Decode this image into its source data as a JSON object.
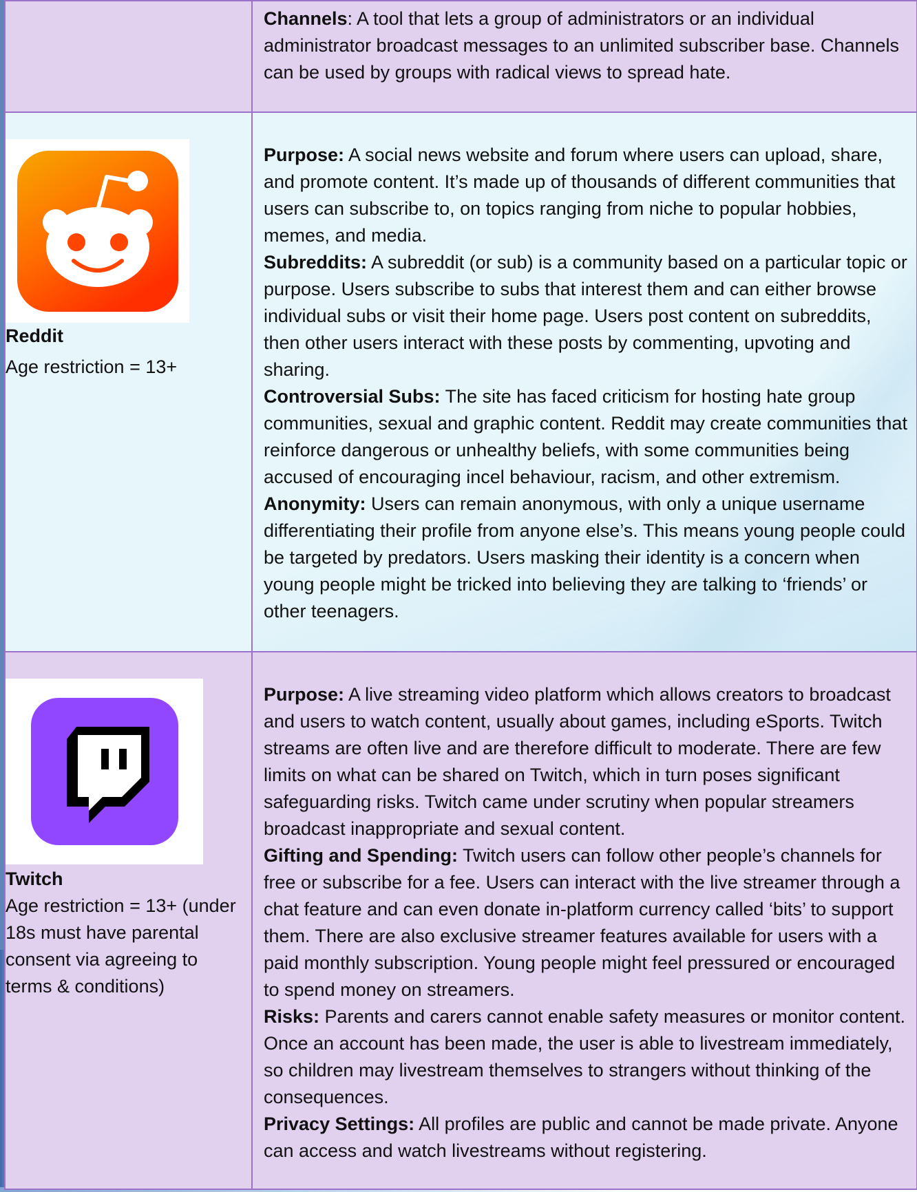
{
  "rows": {
    "channels": {
      "label": "Channels",
      "text": ": A tool that lets a group of administrators or an individual administrator broadcast messages to an unlimited subscriber base. Channels can be used by groups with radical views to spread hate."
    },
    "reddit": {
      "name": "Reddit",
      "age": "Age restriction = 13+",
      "logo_icon": "reddit-alien-icon",
      "colors": {
        "logo_top": "#f7a600",
        "logo_bottom": "#ff3a00"
      },
      "sections": [
        {
          "label": "Purpose:",
          "text": " A social news website and forum where users can upload, share, and promote content. It’s made up of thousands of different communities that users can subscribe to, on topics ranging from niche to popular hobbies, memes, and media."
        },
        {
          "label": "Subreddits:",
          "text": " A subreddit (or sub) is a community based on a particular topic or purpose. Users subscribe to subs that interest them and can either browse individual subs or visit their home page. Users post content on subreddits, then other users interact with these posts by commenting, upvoting and sharing."
        },
        {
          "label": "Controversial Subs:",
          "text": " The site has faced criticism for hosting hate group communities, sexual and graphic content. Reddit may create communities that reinforce dangerous or unhealthy beliefs, with some communities being accused of encouraging incel behaviour, racism, and other extremism."
        },
        {
          "label": "Anonymity:",
          "text": " Users can remain anonymous, with only a unique username differentiating their profile from anyone else’s. This means young people could be targeted by predators. Users masking their identity is a concern when young people might be tricked into believing they are talking to ‘friends’ or other teenagers."
        }
      ]
    },
    "twitch": {
      "name": "Twitch",
      "age": "Age restriction = 13+ (under 18s must have parental consent via agreeing to terms & conditions)",
      "logo_icon": "twitch-glitch-icon",
      "colors": {
        "logo_bg": "#9146ff"
      },
      "sections": [
        {
          "label": "Purpose:",
          "text": " A live streaming video platform which allows creators to broadcast and users to watch content, usually about games, including eSports. Twitch streams are often live and are therefore difficult to moderate. There are few limits on what can be shared on Twitch, which in turn poses significant safeguarding risks. Twitch came under scrutiny when popular streamers broadcast inappropriate and sexual content."
        },
        {
          "label": "Gifting and Spending:",
          "text": " Twitch users can follow other people’s channels for free or subscribe for a fee. Users can interact with the live streamer through a chat feature and can even donate in-platform currency called ‘bits’ to support them. There are also exclusive streamer features available for users with a paid monthly subscription. Young people might feel pressured or encouraged to spend money on streamers."
        },
        {
          "label": "Risks:",
          "text": " Parents and carers cannot enable safety measures or monitor content. Once an account has been made, the user is able to livestream immediately, so children may livestream themselves to strangers without thinking of the consequences."
        },
        {
          "label": "Privacy Settings:",
          "text": " All profiles are public and cannot be made private. Anyone can access and watch livestreams without registering."
        }
      ]
    }
  },
  "theme": {
    "border": "#9b72c9",
    "lilac_row": "#e1d1ef",
    "blue_row": "#e6f6fb"
  }
}
